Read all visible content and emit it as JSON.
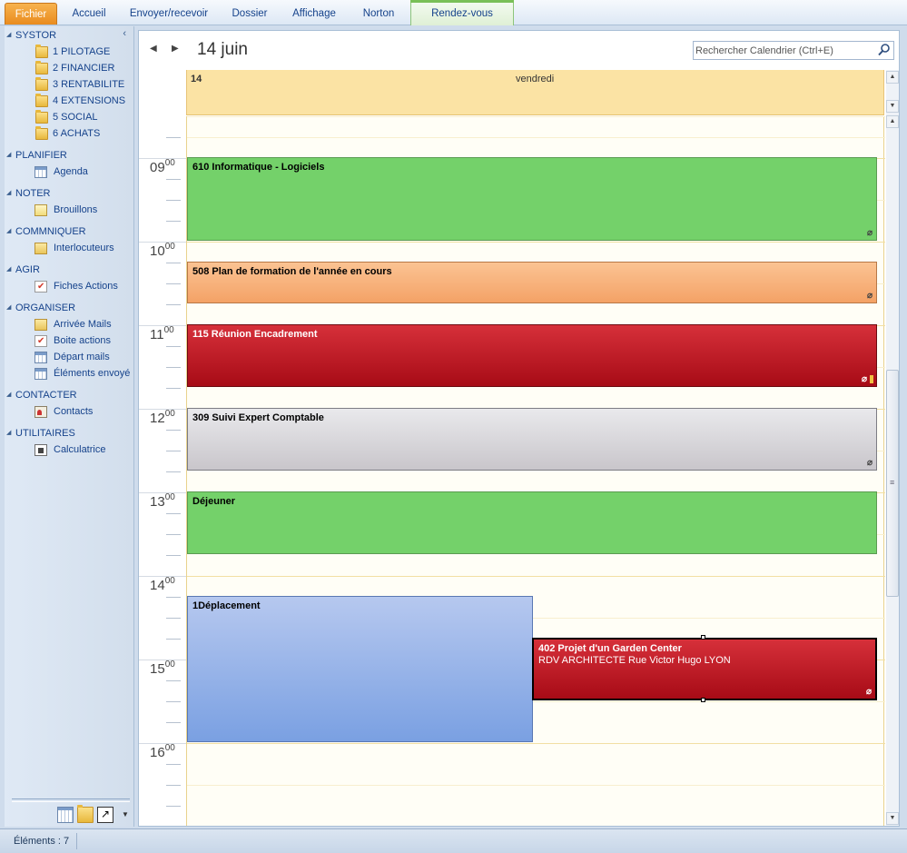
{
  "ribbon": {
    "tabs": [
      {
        "label": "Fichier"
      },
      {
        "label": "Accueil"
      },
      {
        "label": "Envoyer/recevoir"
      },
      {
        "label": "Dossier"
      },
      {
        "label": "Affichage"
      },
      {
        "label": "Norton"
      },
      {
        "label": "Rendez-vous"
      }
    ],
    "active_tab_color": "#e98b1f",
    "contextual_tab_color": "#79c057"
  },
  "nav": {
    "collapse_glyph": "‹",
    "groups": [
      {
        "label": "SYSTOR",
        "items": [
          {
            "label": "1 PILOTAGE",
            "icon": "folder-icon"
          },
          {
            "label": "2 FINANCIER",
            "icon": "folder-icon"
          },
          {
            "label": "3 RENTABILITE",
            "icon": "folder-icon"
          },
          {
            "label": "4 EXTENSIONS",
            "icon": "folder-icon"
          },
          {
            "label": "5 SOCIAL",
            "icon": "folder-icon"
          },
          {
            "label": "6 ACHATS",
            "icon": "folder-icon"
          }
        ]
      },
      {
        "label": "PLANIFIER",
        "items": [
          {
            "label": "Agenda",
            "icon": "calendar-icon"
          }
        ]
      },
      {
        "label": "NOTER",
        "items": [
          {
            "label": "Brouillons",
            "icon": "drafts-icon"
          }
        ]
      },
      {
        "label": "COMMNIQUER",
        "items": [
          {
            "label": "Interlocuteurs",
            "icon": "envelope-icon"
          }
        ]
      },
      {
        "label": "AGIR",
        "items": [
          {
            "label": "Fiches Actions",
            "icon": "task-icon"
          }
        ]
      },
      {
        "label": "ORGANISER",
        "items": [
          {
            "label": "Arrivée Mails",
            "icon": "inbox-icon"
          },
          {
            "label": "Boite actions",
            "icon": "task-icon"
          },
          {
            "label": "Départ mails",
            "icon": "outbox-icon"
          },
          {
            "label": "Éléments envoyé",
            "icon": "sent-icon"
          }
        ]
      },
      {
        "label": "CONTACTER",
        "items": [
          {
            "label": "Contacts",
            "icon": "contact-card-icon"
          }
        ]
      },
      {
        "label": "UTILITAIRES",
        "items": [
          {
            "label": "Calculatrice",
            "icon": "calculator-icon"
          }
        ]
      }
    ]
  },
  "calendar": {
    "date_title": "14 juin",
    "search_placeholder": "Rechercher Calendrier (Ctrl+E)",
    "day_number": "14",
    "day_name": "vendredi",
    "hours": [
      {
        "h": "09",
        "m": "00"
      },
      {
        "h": "10",
        "m": "00"
      },
      {
        "h": "11",
        "m": "00"
      },
      {
        "h": "12",
        "m": "00"
      },
      {
        "h": "13",
        "m": "00"
      },
      {
        "h": "14",
        "m": "00"
      },
      {
        "h": "15",
        "m": "00"
      },
      {
        "h": "16",
        "m": "00"
      }
    ],
    "appointments": [
      {
        "title": "610 Informatique - Logiciels",
        "color": "#74d16a"
      },
      {
        "title": "508 Plan de formation de l'année en cours",
        "color": "#f4a266"
      },
      {
        "title": "115 Réunion Encadrement",
        "color": "#c0202b"
      },
      {
        "title": "309 Suivi Expert Comptable",
        "color": "#d6d4d9"
      },
      {
        "title": "Déjeuner",
        "color": "#74d16a"
      },
      {
        "title": "1Déplacement",
        "color": "#9ab5ea"
      },
      {
        "title": "402 Projet d'un Garden Center",
        "subtitle": "RDV ARCHITECTE       Rue Victor Hugo  LYON",
        "color": "#c0202b"
      }
    ]
  },
  "status": {
    "items_label": "Éléments : 7"
  }
}
